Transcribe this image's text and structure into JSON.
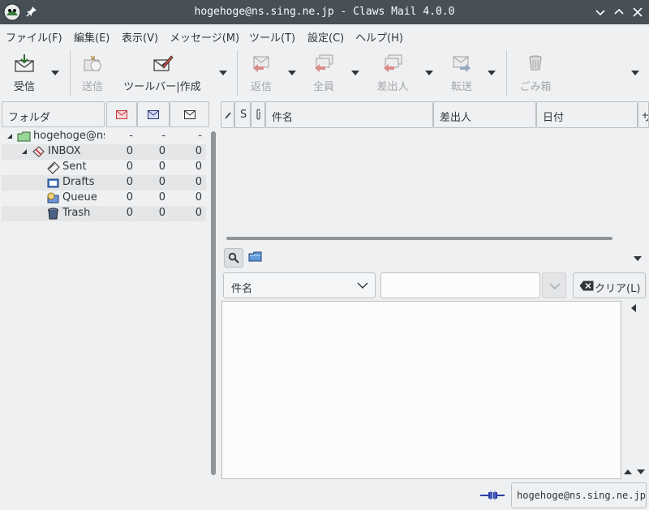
{
  "window": {
    "title": "hogehoge@ns.sing.ne.jp - Claws Mail 4.0.0"
  },
  "menu": [
    "ファイル(F)",
    "編集(E)",
    "表示(V)",
    "メッセージ(M)",
    "ツール(T)",
    "設定(C)",
    "ヘルプ(H)"
  ],
  "toolbar": {
    "receive": "受信",
    "send": "送信",
    "compose": "ツールバー|作成",
    "reply": "返信",
    "reply_all": "全員",
    "reply_sender": "差出人",
    "forward": "転送",
    "trash": "ごみ箱"
  },
  "folder_pane": {
    "header": "フォルダ",
    "columns": [
      "new-mail-icon",
      "unread-mail-icon",
      "total-mail-icon"
    ],
    "rows": [
      {
        "name": "hogehoge@ns",
        "icon": "account-folder-icon",
        "new": "-",
        "unread": "-",
        "total": "-"
      },
      {
        "name": "INBOX",
        "icon": "inbox-icon",
        "new": "0",
        "unread": "0",
        "total": "0"
      },
      {
        "name": "Sent",
        "icon": "sent-icon",
        "new": "0",
        "unread": "0",
        "total": "0"
      },
      {
        "name": "Drafts",
        "icon": "drafts-icon",
        "new": "0",
        "unread": "0",
        "total": "0"
      },
      {
        "name": "Queue",
        "icon": "queue-icon",
        "new": "0",
        "unread": "0",
        "total": "0"
      },
      {
        "name": "Trash",
        "icon": "trash-icon",
        "new": "0",
        "unread": "0",
        "total": "0"
      }
    ]
  },
  "message_list": {
    "columns": {
      "mark": "",
      "status": "S",
      "attachment": "",
      "subject": "件名",
      "from": "差出人",
      "date": "日付",
      "size": "サ"
    }
  },
  "search": {
    "field_option": "件名",
    "value": "",
    "clear_label": "クリア(L)"
  },
  "status": {
    "account": "hogehoge@ns.sing.ne.jp"
  },
  "colors": {
    "titlebar": "#475057",
    "background": "#eff0f1",
    "accent": "#3daee9"
  }
}
